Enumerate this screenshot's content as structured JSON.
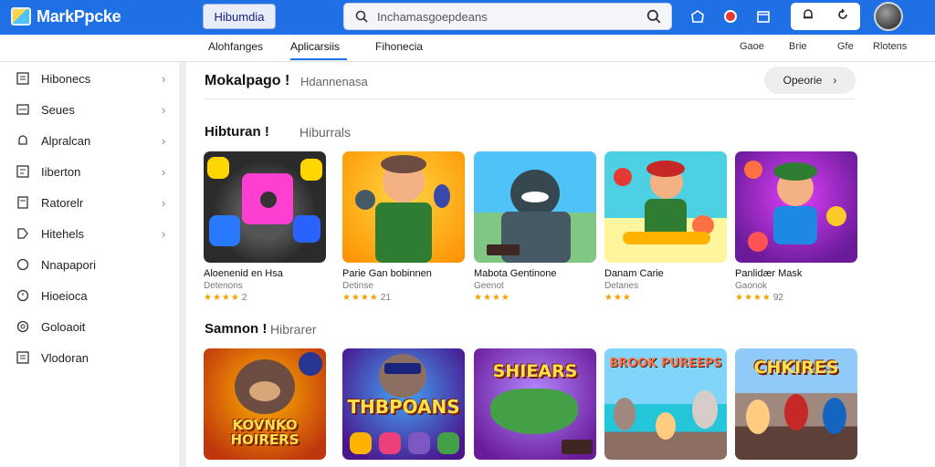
{
  "app": {
    "title": "MarkPpcke"
  },
  "header": {
    "chip_label": "Hibumdia",
    "search_placeholder": "Inchamasgoepdeans",
    "icons": [
      "store-icon",
      "notification-icon",
      "calendar-icon",
      "bell-icon",
      "refresh-icon"
    ]
  },
  "subnav": {
    "tabs": [
      {
        "label": "Alohfanges",
        "active": false
      },
      {
        "label": "Aplicarsiis",
        "active": true
      },
      {
        "label": "Fihonecia",
        "active": false
      }
    ],
    "right_links": [
      "Gaoe",
      "Brie",
      "Gfe",
      "Rlotens"
    ]
  },
  "sidebar": {
    "items": [
      {
        "label": "Hibonecs",
        "icon": "grid-icon",
        "chevron": true
      },
      {
        "label": "Seues",
        "icon": "chart-icon",
        "chevron": true
      },
      {
        "label": "Alpralcan",
        "icon": "bell-outline-icon",
        "chevron": true
      },
      {
        "label": "Iiberton",
        "icon": "list-icon",
        "chevron": true
      },
      {
        "label": "Ratorelr",
        "icon": "document-icon",
        "chevron": true
      },
      {
        "label": "Hitehels",
        "icon": "tag-icon",
        "chevron": true
      },
      {
        "label": "Nnapapori",
        "icon": "circle-icon",
        "chevron": false
      },
      {
        "label": "Hioeioca",
        "icon": "clock-icon",
        "chevron": false
      },
      {
        "label": "Goloaoit",
        "icon": "globe-icon",
        "chevron": false
      },
      {
        "label": "Vlodoran",
        "icon": "square-list-icon",
        "chevron": false
      }
    ]
  },
  "main": {
    "title": "Mokalpago",
    "subtitle": "Hdannenasa",
    "open_button": "Opeorie",
    "sections": [
      {
        "title": "Hibturan",
        "subtitle": "Hiburrals",
        "cards": [
          {
            "name": "Aloenenid en Hsa",
            "developer": "Detenons",
            "stars": "★★★★",
            "count": "2"
          },
          {
            "name": "Parie Gan bobinnen",
            "developer": "Detinse",
            "stars": "★★★★",
            "count": "21"
          },
          {
            "name": "Mabota Gentinone",
            "developer": "Geenot",
            "stars": "★★★★",
            "count": ""
          },
          {
            "name": "Danam Carie",
            "developer": "Detanes",
            "stars": "★★★",
            "count": ""
          },
          {
            "name": "Panlidær Mask",
            "developer": "Gaonok",
            "stars": "★★★★",
            "count": "92"
          }
        ]
      },
      {
        "title": "Samnon",
        "subtitle": "Hibrarer",
        "cards": [
          {
            "art_text": "KOVNKO HOIRERS"
          },
          {
            "art_text": "THBPOANS"
          },
          {
            "art_text": "SHIEARS"
          },
          {
            "art_text": "BROOK PUREEPS"
          },
          {
            "art_text": "CHKIRES"
          }
        ]
      }
    ]
  }
}
